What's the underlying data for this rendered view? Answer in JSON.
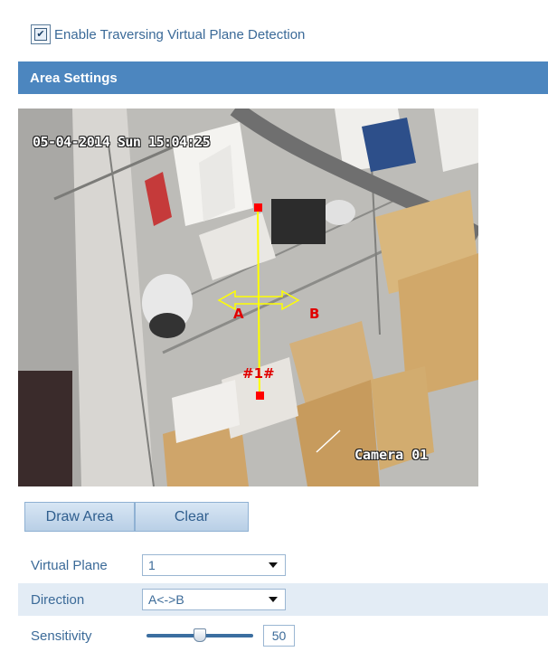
{
  "enable": {
    "label": "Enable Traversing Virtual Plane Detection",
    "checked": true
  },
  "area_settings": {
    "title": "Area Settings"
  },
  "video": {
    "timestamp": "05-04-2014 Sun 15:04:25",
    "camera_name": "Camera 01",
    "marker_a": "A",
    "marker_b": "B",
    "plane_id": "#1#"
  },
  "buttons": {
    "draw_area": "Draw Area",
    "clear": "Clear"
  },
  "virtual_plane": {
    "label": "Virtual Plane",
    "value": "1"
  },
  "direction": {
    "label": "Direction",
    "value": "A<->B"
  },
  "sensitivity": {
    "label": "Sensitivity",
    "value": "50",
    "level": 0.5
  },
  "colors": {
    "header": "#4c86bf",
    "accent": "#3b6a98",
    "plane_line": "#ffff00",
    "marker": "#e00000"
  }
}
